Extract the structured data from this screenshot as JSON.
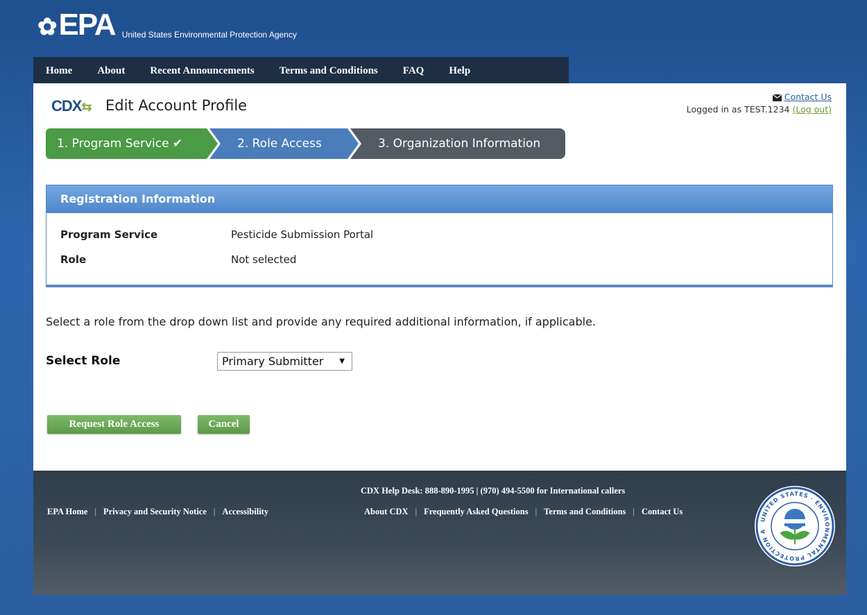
{
  "header": {
    "logo_text": "EPA",
    "agency_name": "United States Environmental Protection Agency"
  },
  "nav": {
    "items": [
      "Home",
      "About",
      "Recent Announcements",
      "Terms and Conditions",
      "FAQ",
      "Help"
    ]
  },
  "page": {
    "logo_text": "CDX",
    "title": "Edit Account Profile",
    "contact_label": "Contact Us",
    "logged_in_prefix": "Logged in as TEST.1234",
    "logout_label": "(Log out)"
  },
  "steps": [
    {
      "label": "1. Program Service ✔",
      "status": "complete",
      "color": "#4a9a46"
    },
    {
      "label": "2. Role Access",
      "status": "current",
      "color": "#4b7dbb"
    },
    {
      "label": "3. Organization Information",
      "status": "upcoming",
      "color": "#555b62"
    }
  ],
  "registration": {
    "heading": "Registration Information",
    "rows": [
      {
        "label": "Program Service",
        "value": "Pesticide Submission Portal"
      },
      {
        "label": "Role",
        "value": "Not selected"
      }
    ]
  },
  "form": {
    "instructions": "Select a role from the drop down list and provide any required additional information, if applicable.",
    "select_label": "Select Role",
    "select_value": "Primary Submitter"
  },
  "buttons": {
    "request": "Request Role Access",
    "cancel": "Cancel"
  },
  "footer": {
    "help_desk": "CDX Help Desk: 888-890-1995 | (970) 494-5500 for International callers",
    "left_links": [
      "EPA Home",
      "Privacy and Security Notice",
      "Accessibility"
    ],
    "right_links": [
      "About CDX",
      "Frequently Asked Questions",
      "Terms and Conditions",
      "Contact Us"
    ],
    "seal_text": "UNITED STATES · ENVIRONMENTAL PROTECTION AGENCY"
  },
  "icons": {
    "contact": "envelope-icon",
    "caret": "caret-down-icon",
    "seal": "epa-seal-icon"
  }
}
